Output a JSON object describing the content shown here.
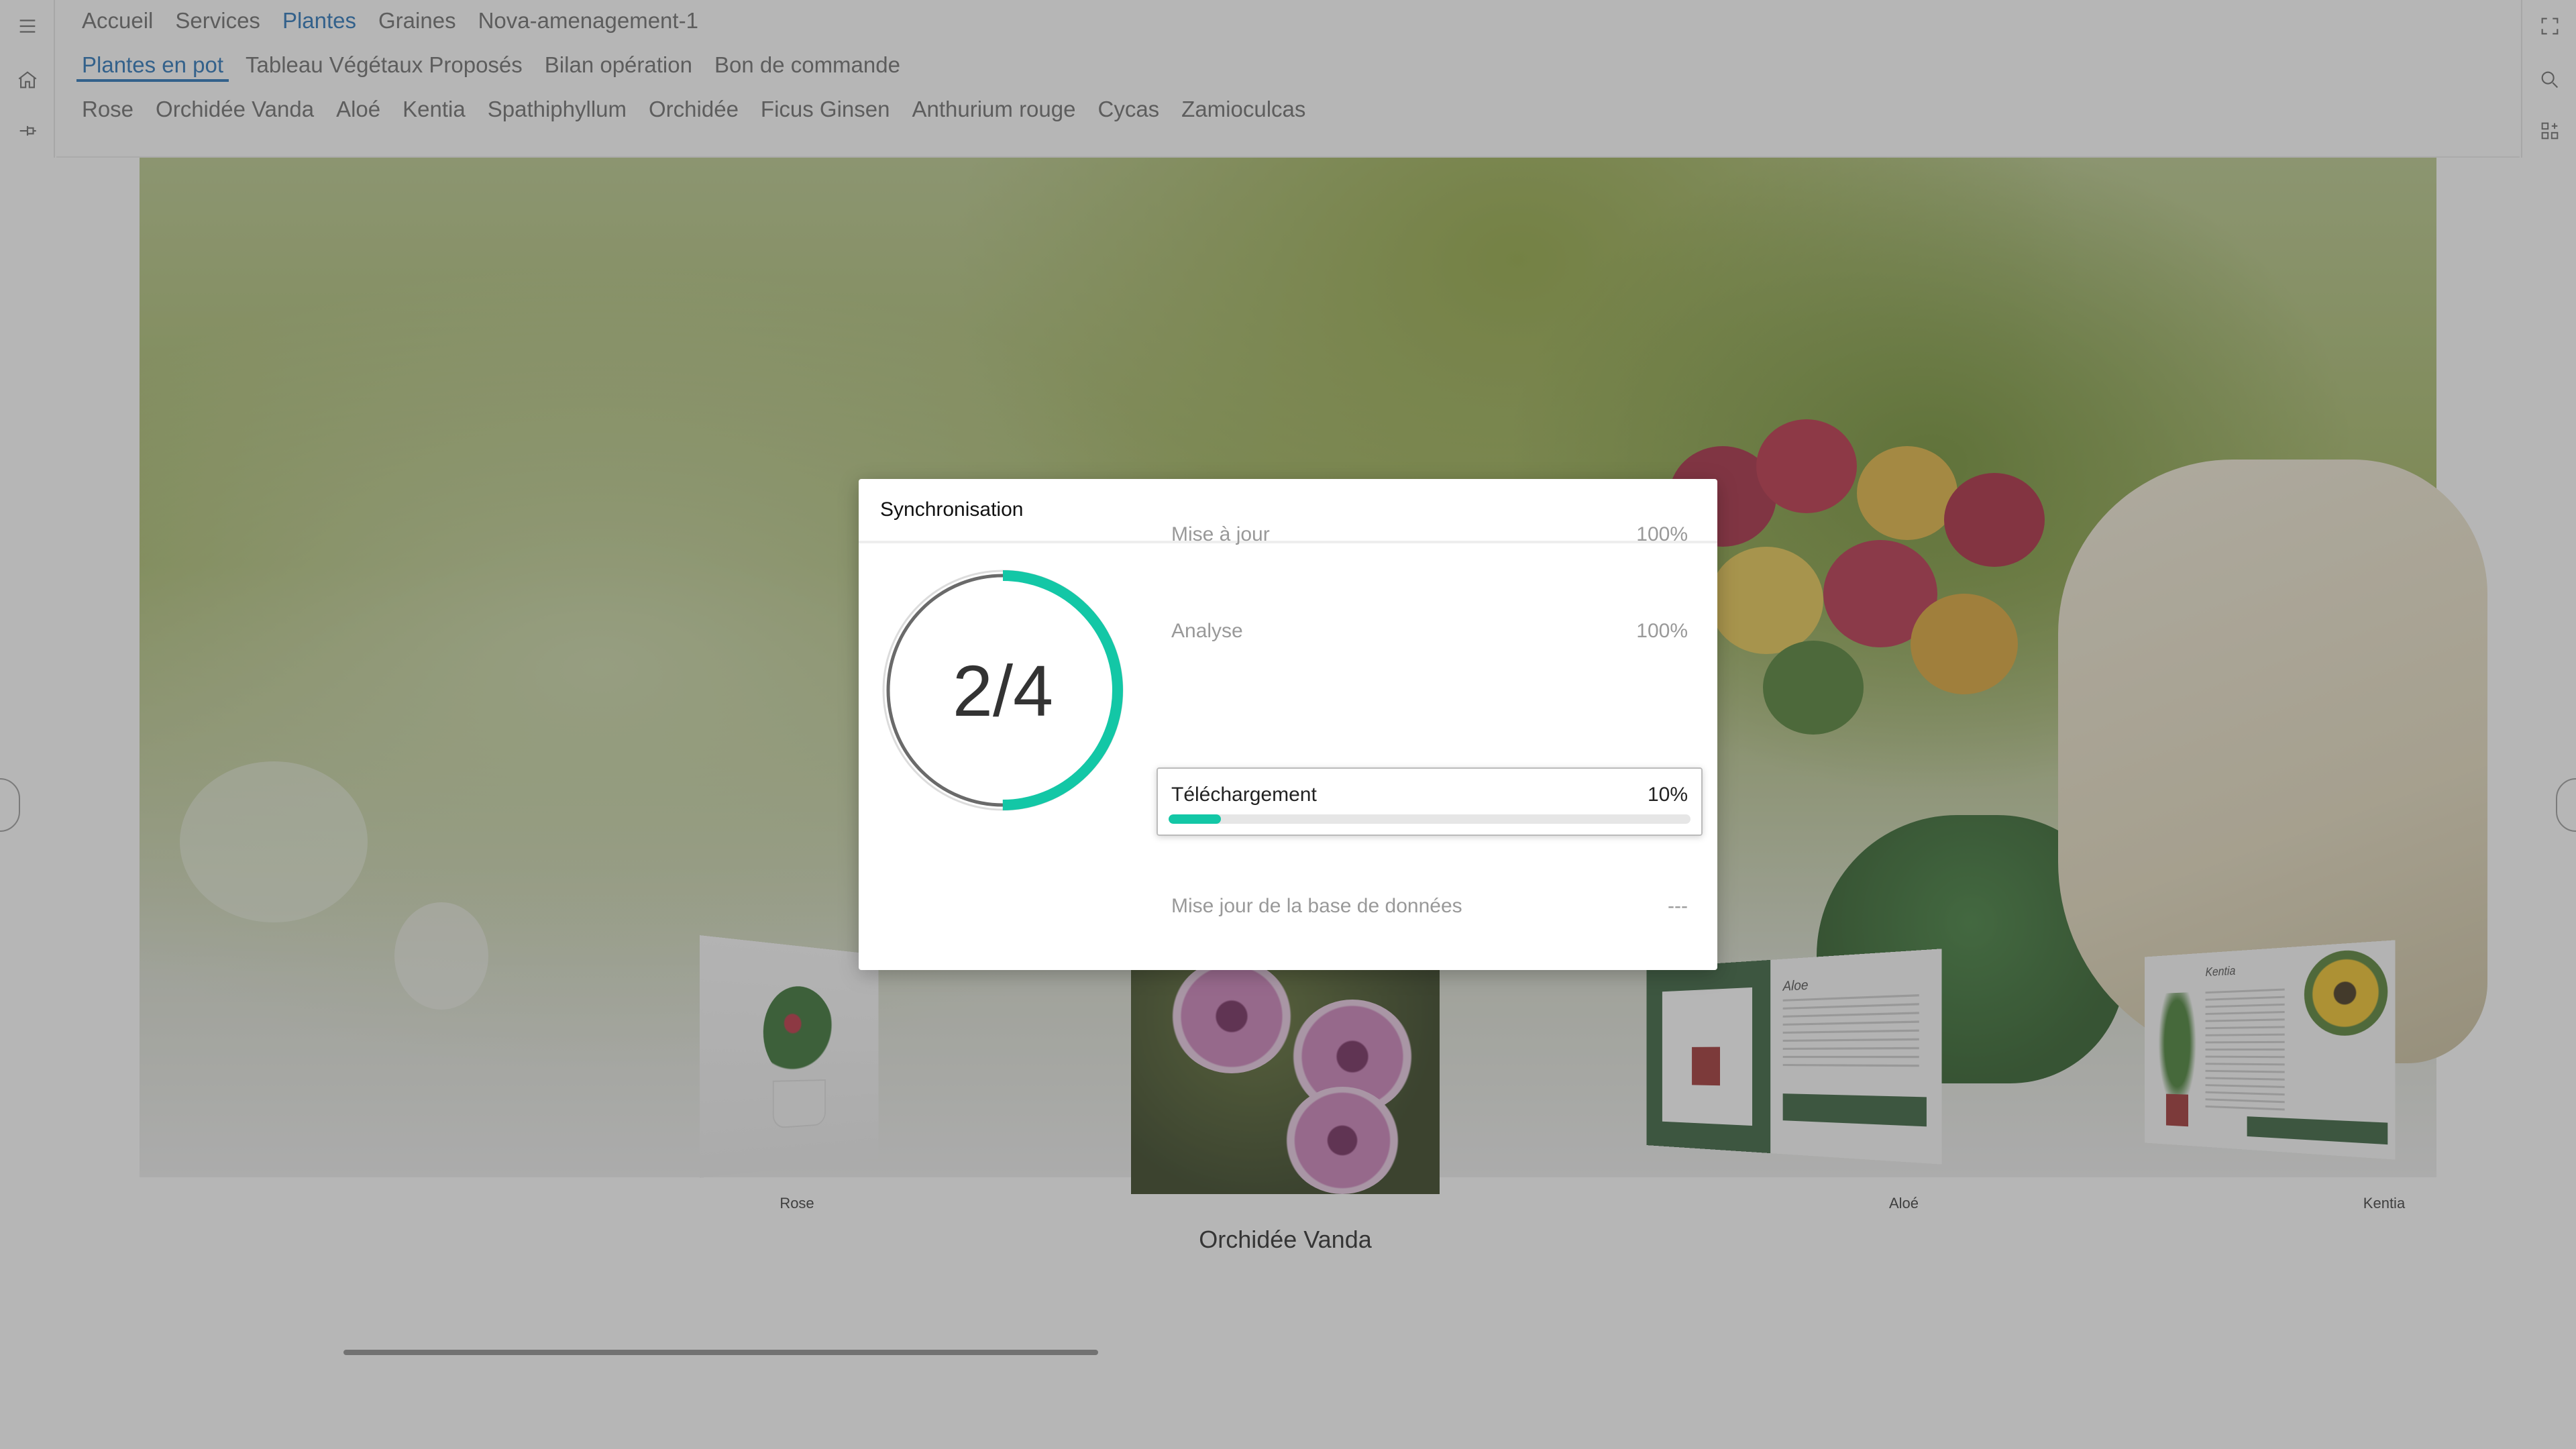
{
  "header": {
    "row1": [
      "Accueil",
      "Services",
      "Plantes",
      "Graines",
      "Nova-amenagement-1"
    ],
    "row1_active": 2,
    "row2": [
      "Plantes en pot",
      "Tableau Végétaux Proposés",
      "Bilan opération",
      "Bon de commande"
    ],
    "row2_active": 0,
    "row3": [
      "Rose",
      "Orchidée Vanda",
      "Aloé",
      "Kentia",
      "Spathiphyllum",
      "Orchidée",
      "Ficus Ginsen",
      "Anthurium rouge",
      "Cycas",
      "Zamioculcas"
    ]
  },
  "rail_left": [
    "menu-icon",
    "home-icon",
    "pin-icon"
  ],
  "rail_right": [
    "fullscreen-icon",
    "search-icon",
    "grid-add-icon"
  ],
  "carousel": {
    "cards": [
      {
        "label": "Rose"
      },
      {
        "label": "Orchidée Vanda"
      },
      {
        "label": "Aloé"
      },
      {
        "label": "Kentia"
      }
    ],
    "focused_title": "Orchidée Vanda",
    "aloe_heading": "Aloe",
    "kentia_heading": "Kentia"
  },
  "dialog": {
    "title": "Synchronisation",
    "counter": "2/4",
    "progress_fraction": 0.5,
    "accent_color": "#13c7a6",
    "steps": [
      {
        "label": "Mise à jour",
        "value": "100%",
        "active": false
      },
      {
        "label": "Analyse",
        "value": "100%",
        "active": false
      },
      {
        "label": "Téléchargement",
        "value": "10%",
        "active": true,
        "progress": 0.1
      },
      {
        "label": "Mise jour de la base de données",
        "value": "---",
        "active": false
      }
    ]
  }
}
